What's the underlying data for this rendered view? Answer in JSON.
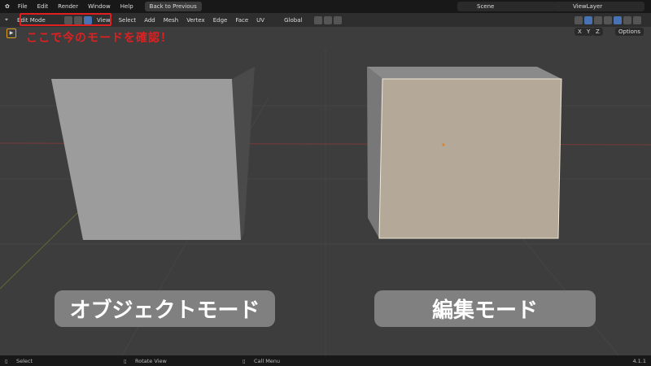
{
  "topbar": {
    "menus": [
      "File",
      "Edit",
      "Render",
      "Window",
      "Help"
    ],
    "back_button": "Back to Previous",
    "scene": "Scene",
    "view_layer": "ViewLayer"
  },
  "header": {
    "mode": "Edit Mode",
    "menus": [
      "View",
      "Select",
      "Add",
      "Mesh",
      "Vertex",
      "Edge",
      "Face",
      "UV"
    ],
    "orientation": "Global",
    "axes": [
      "X",
      "Y",
      "Z"
    ],
    "options": "Options"
  },
  "annotation": "ここで今のモードを確認！",
  "labels": {
    "object_mode": "オブジェクトモード",
    "edit_mode": "編集モード"
  },
  "status": {
    "select": "Select",
    "rotate": "Rotate View",
    "call_menu": "Call Menu",
    "version": "4.1.1"
  },
  "colors": {
    "accent": "#4772b3",
    "annotation": "#e02020"
  }
}
